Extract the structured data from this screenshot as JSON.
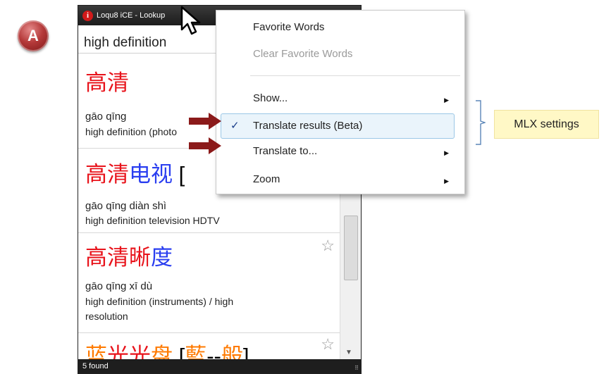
{
  "badge": {
    "label": "A"
  },
  "window": {
    "title": "Loqu8 iCE - Lookup",
    "search_text": "high definition",
    "status": "5 found",
    "entries": [
      {
        "chars": [
          {
            "t": "高清",
            "c": "r"
          }
        ],
        "pinyin": "gāo qīng",
        "definition": "high definition (photo"
      },
      {
        "chars": [
          {
            "t": "高清",
            "c": "r"
          },
          {
            "t": "电视",
            "c": "b"
          },
          {
            "t": " [",
            "c": "k"
          }
        ],
        "pinyin": "gāo qīng diàn shì",
        "definition": "high definition television HDTV"
      },
      {
        "chars": [
          {
            "t": "高清晰",
            "c": "r"
          },
          {
            "t": "度",
            "c": "b"
          }
        ],
        "pinyin": "gāo qīng xī dù",
        "definition_lines": [
          "high definition (instruments) / high",
          "resolution"
        ]
      },
      {
        "chars": [
          {
            "t": "蓝",
            "c": "o"
          },
          {
            "t": "光光",
            "c": "r"
          },
          {
            "t": "盘",
            "c": "o"
          },
          {
            "t": " [",
            "c": "k"
          },
          {
            "t": "藍",
            "c": "o"
          },
          {
            "t": "--",
            "c": "k"
          },
          {
            "t": "般",
            "c": "o"
          },
          {
            "t": "]",
            "c": "k"
          }
        ]
      }
    ]
  },
  "menu": {
    "items": [
      {
        "label": "Favorite Words",
        "disabled": false
      },
      {
        "label": "Clear Favorite Words",
        "disabled": true
      },
      {
        "label": "Show...",
        "submenu": true
      },
      {
        "label": "Translate results (Beta)",
        "checked": true
      },
      {
        "label": "Translate to...",
        "submenu": true
      },
      {
        "label": "Zoom",
        "submenu": true
      }
    ]
  },
  "callout": {
    "label": "MLX settings"
  },
  "icons": {
    "favorite": "star-outline-icon",
    "check": "checkmark-icon",
    "submenu": "triangle-right-icon"
  }
}
